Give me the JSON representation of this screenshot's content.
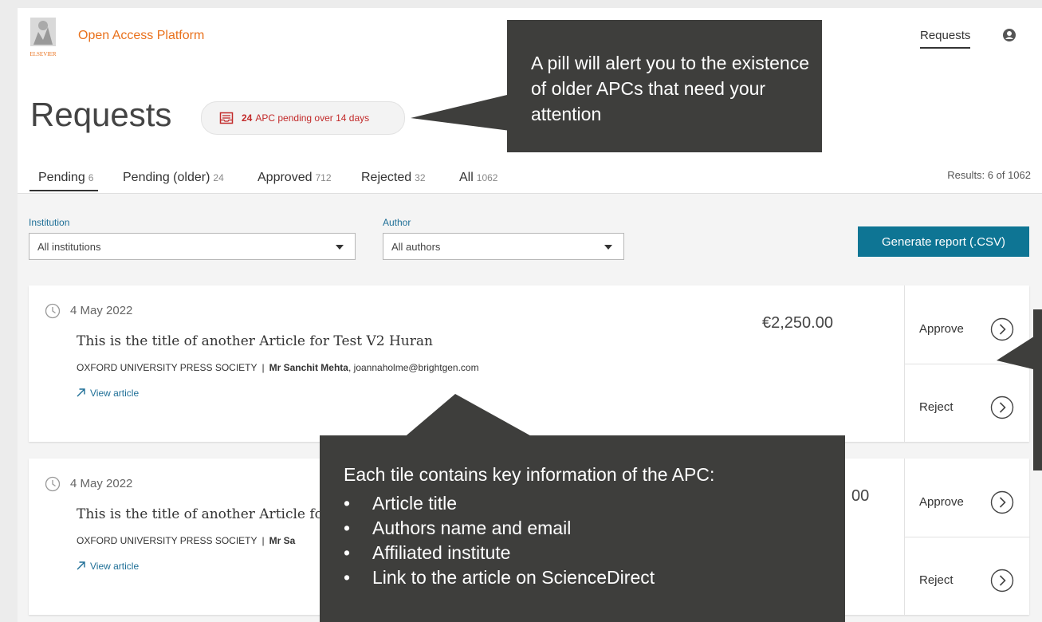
{
  "header": {
    "brand": "Open Access Platform",
    "logo_text": "ELSEVIER",
    "nav_requests": "Requests",
    "page_title": "Requests",
    "pill_count": "24",
    "pill_text": "APC pending over 14 days"
  },
  "tabs": [
    {
      "label": "Pending",
      "count": "6"
    },
    {
      "label": "Pending (older)",
      "count": "24"
    },
    {
      "label": "Approved",
      "count": "712"
    },
    {
      "label": "Rejected",
      "count": "32"
    },
    {
      "label": "All",
      "count": "1062"
    }
  ],
  "results": "Results: 6 of 1062",
  "filters": {
    "institution_label": "Institution",
    "institution_value": "All institutions",
    "author_label": "Author",
    "author_value": "All authors",
    "generate_label": "Generate report (.CSV)"
  },
  "tiles": [
    {
      "date": "4 May 2022",
      "title": "This is the title of another Article for Test V2 Huran",
      "publisher": "OXFORD UNIVERSITY PRESS SOCIETY",
      "author": "Mr Sanchit Mehta",
      "email": ", joannaholme@brightgen.com",
      "view": "View article",
      "price": "€2,250.00",
      "approve": "Approve",
      "reject": "Reject"
    },
    {
      "date": "4 May 2022",
      "title": "This is the title of another Article fo",
      "publisher": "OXFORD UNIVERSITY PRESS SOCIETY",
      "author": "Mr Sa",
      "view": "View article",
      "price": "00",
      "approve": "Approve",
      "reject": "Reject"
    }
  ],
  "callouts": {
    "pill_note": "A pill will alert you to the existence of older APCs that need your attention",
    "tile_head": "Each tile contains key information of the APC:",
    "tile_items": [
      "Article title",
      "Authors name and email",
      "Affiliated institute",
      "Link to the article on ScienceDirect"
    ]
  },
  "colors": {
    "brand_orange": "#e9711c",
    "accent_teal": "#0e7594",
    "alert_red": "#c22a2a",
    "callout_bg": "#3e3e3c"
  }
}
